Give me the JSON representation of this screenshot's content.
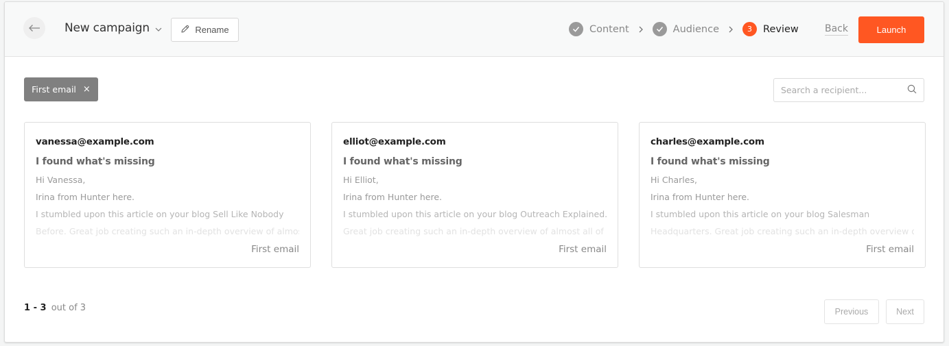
{
  "header": {
    "back_icon": "arrow-left-icon",
    "campaign_title": "New campaign",
    "title_dropdown_icon": "chevron-down-icon",
    "rename_label": "Rename",
    "rename_icon": "pencil-icon",
    "steps": [
      {
        "label": "Content",
        "state": "done",
        "icon": "check-icon"
      },
      {
        "label": "Audience",
        "state": "done",
        "icon": "check-icon"
      },
      {
        "label": "Review",
        "state": "active",
        "number": "3"
      }
    ],
    "back_label": "Back",
    "launch_label": "Launch",
    "accent_color": "#ff5722"
  },
  "filter": {
    "chip_label": "First email",
    "chip_close": "×"
  },
  "search": {
    "placeholder": "Search a recipient...",
    "value": "",
    "icon": "search-icon"
  },
  "cards": [
    {
      "email": "vanessa@example.com",
      "subject": "I found what's missing",
      "greeting": "Hi Vanessa,",
      "intro": "Irina from Hunter here.",
      "line3": "I stumbled upon this article on your blog Sell Like Nobody",
      "line4": "Before. Great job creating such an in-depth overview of almost",
      "step": "First email"
    },
    {
      "email": "elliot@example.com",
      "subject": "I found what's missing",
      "greeting": "Hi Elliot,",
      "intro": "Irina from Hunter here.",
      "line3": "I stumbled upon this article on your blog Outreach Explained.",
      "line4": "Great job creating such an in-depth overview of almost all of",
      "step": "First email"
    },
    {
      "email": "charles@example.com",
      "subject": "I found what's missing",
      "greeting": "Hi Charles,",
      "intro": "Irina from Hunter here.",
      "line3": "I stumbled upon this article on your blog Salesman",
      "line4": "Headquarters. Great job creating such an in-depth overview of",
      "step": "First email"
    }
  ],
  "pagination": {
    "range": "1 - 3",
    "total_text": "out of 3",
    "previous_label": "Previous",
    "next_label": "Next"
  }
}
